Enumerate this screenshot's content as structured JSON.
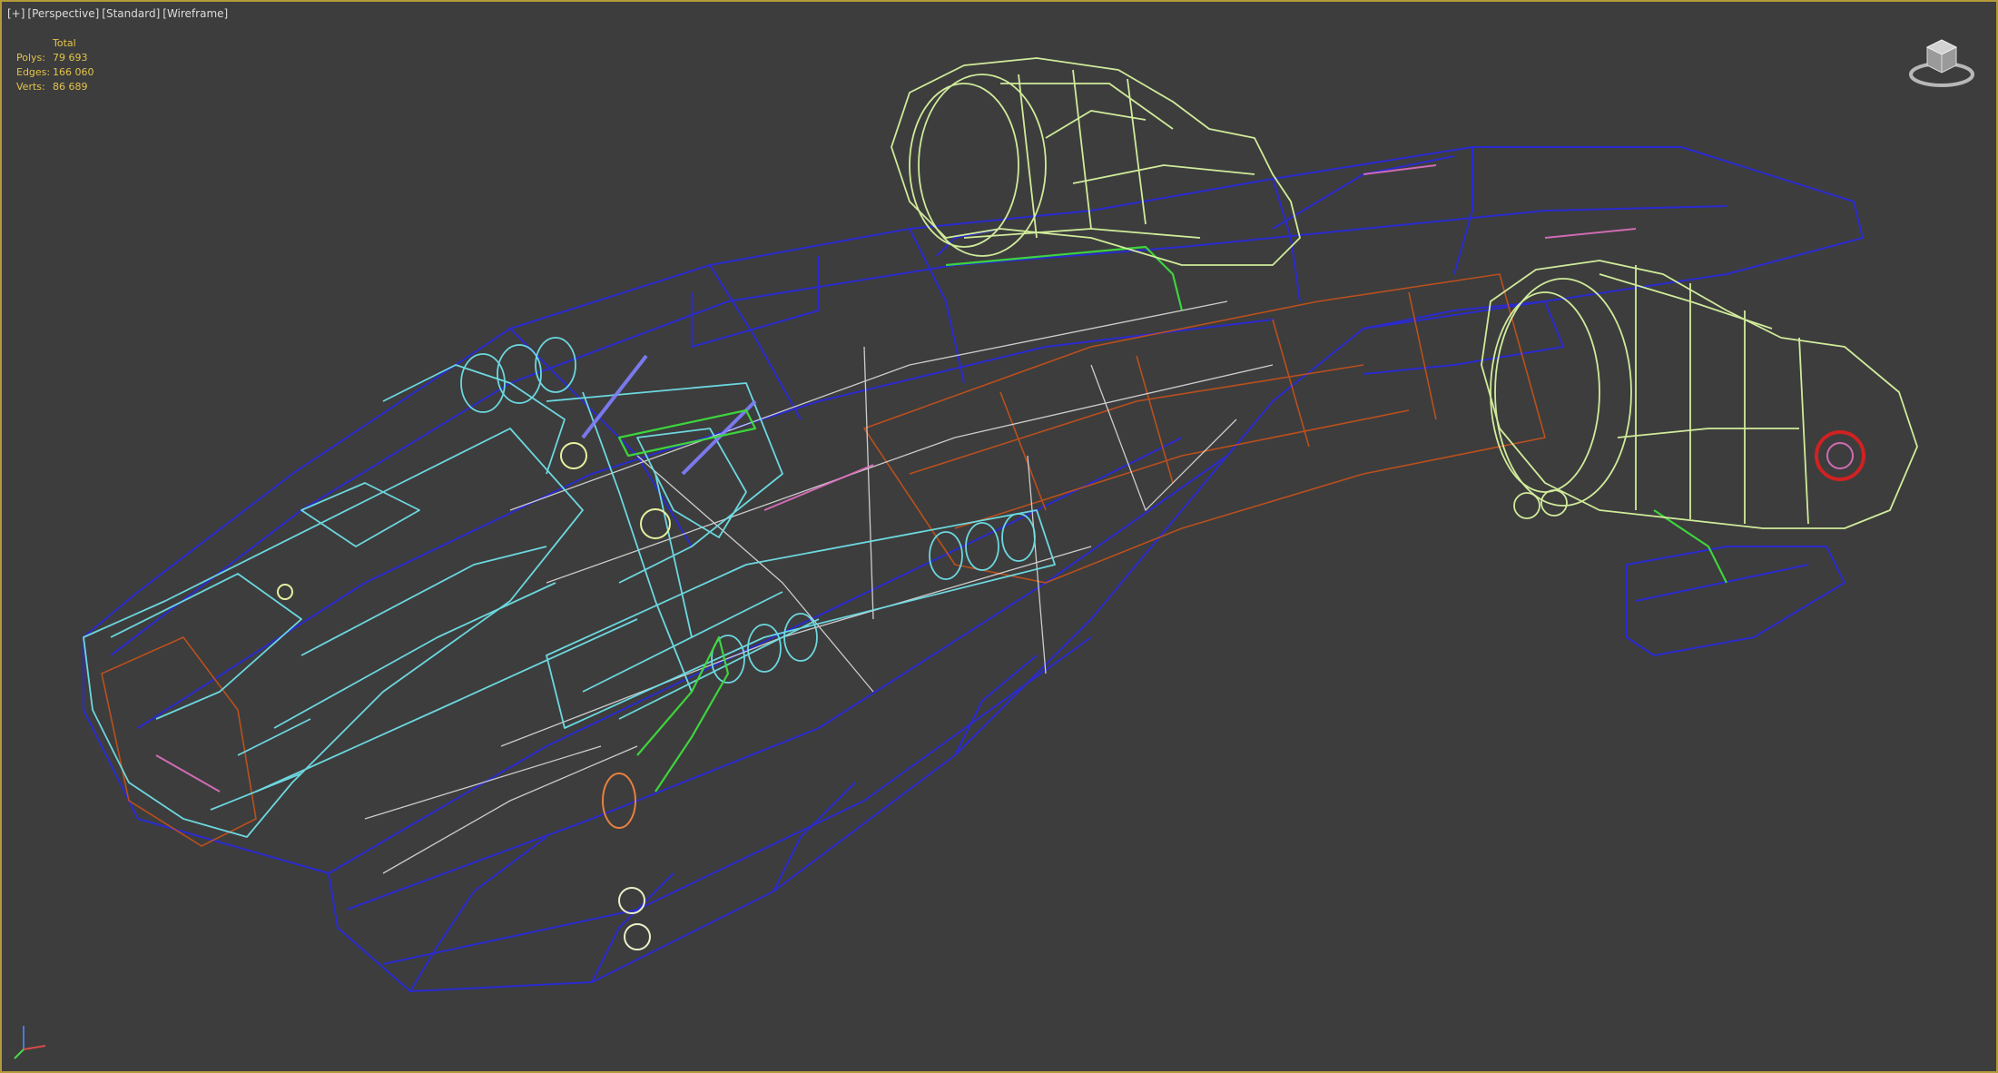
{
  "viewport": {
    "labels": [
      "[+]",
      "[Perspective]",
      "[Standard]",
      "[Wireframe]"
    ],
    "border_color": "#b49a3a",
    "background": "#3d3d3d"
  },
  "stats": {
    "header": "Total",
    "rows": [
      {
        "label": "Polys:",
        "value": "79 693"
      },
      {
        "label": "Edges:",
        "value": "166 060"
      },
      {
        "label": "Verts:",
        "value": "86 689"
      }
    ]
  },
  "icons": {
    "viewcube": "viewcube-icon",
    "axis": "axis-tripod-icon"
  },
  "colors": {
    "hull": "#2a2ad8",
    "cockpit": "#6fe0e8",
    "engine": "#d8f5a0",
    "interior": "#c8521a",
    "accent_green": "#3ddc3d",
    "accent_pink": "#e070c0"
  }
}
